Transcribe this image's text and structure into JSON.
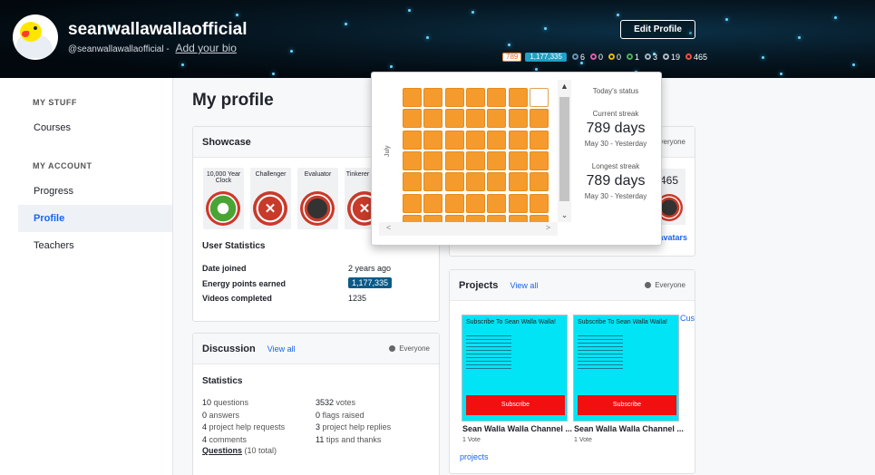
{
  "header": {
    "username": "seanwallawallaofficial",
    "handle": "@seanwallawallaofficial",
    "handle_sep": "-",
    "bio_link": "Add your bio",
    "edit_profile": "Edit Profile",
    "streak": "789",
    "points": "1,177,335",
    "badges": [
      {
        "count": "6",
        "color": "#6b8fb8",
        "icon": "meteorite-badge-icon"
      },
      {
        "count": "0",
        "color": "#e85aa6",
        "icon": "moon-badge-icon"
      },
      {
        "count": "0",
        "color": "#f2b500",
        "icon": "earth-badge-icon"
      },
      {
        "count": "1",
        "color": "#4cb24f",
        "icon": "sun-badge-icon"
      },
      {
        "count": "3",
        "color": "#9fb3c2",
        "icon": "black-hole-badge-icon"
      },
      {
        "count": "19",
        "color": "#b0b8c0",
        "icon": "challenge-patch-icon"
      },
      {
        "count": "465",
        "color": "#e8553d",
        "icon": "avatar-badge-icon"
      }
    ]
  },
  "sidebar": {
    "my_stuff": "MY STUFF",
    "courses": "Courses",
    "my_account": "MY ACCOUNT",
    "progress": "Progress",
    "profile": "Profile",
    "teachers": "Teachers"
  },
  "main": {
    "title": "My profile",
    "showcase": {
      "title": "Showcase",
      "badges": [
        {
          "label": "10,000 Year Clock",
          "icon": "gear-medal-icon"
        },
        {
          "label": "Challenger",
          "icon": "tools-medal-icon"
        },
        {
          "label": "Evaluator",
          "icon": "meteor-medal-icon"
        },
        {
          "label": "Tinkerer",
          "icon": "tools-medal-icon"
        }
      ]
    },
    "user_statistics": {
      "title": "User Statistics",
      "date_joined_label": "Date joined",
      "date_joined": "2 years ago",
      "energy_label": "Energy points earned",
      "energy": "1,177,335",
      "videos_label": "Videos completed",
      "videos": "1235"
    },
    "avatar_card": {
      "visibility": "Everyone",
      "count": "465",
      "link": "ll avatars"
    },
    "discussion": {
      "title": "Discussion",
      "view_all": "View all",
      "visibility": "Everyone",
      "stats_title": "Statistics",
      "left": [
        {
          "n": "10",
          "label": "questions"
        },
        {
          "n": "0",
          "label": "answers"
        },
        {
          "n": "4",
          "label": "project help requests"
        },
        {
          "n": "4",
          "label": "comments"
        }
      ],
      "right": [
        {
          "n": "3532",
          "label": "votes"
        },
        {
          "n": "0",
          "label": "flags raised"
        },
        {
          "n": "3",
          "label": "project help replies"
        },
        {
          "n": "11",
          "label": "tips and thanks"
        }
      ],
      "questions_link": "Questions",
      "questions_total": "(10 total)"
    },
    "projects": {
      "title": "Projects",
      "view_all": "View all",
      "visibility": "Everyone",
      "more": "Cus",
      "items": [
        {
          "thumb_title": "Subscribe To Sean Walla Walla!",
          "button": "Subscribe",
          "title": "Sean Walla Walla Channel ...",
          "votes": "1 Vote"
        },
        {
          "thumb_title": "Subscribe To Sean Walla Walla!",
          "button": "Subscribe",
          "title": "Sean Walla Walla Channel ...",
          "votes": "1 Vote"
        }
      ],
      "footer_link": "projects"
    }
  },
  "streak_popover": {
    "month": "July",
    "today_status": "Today's status",
    "current_label": "Current streak",
    "current_value": "789 days",
    "current_range": "May 30 - Yesterday",
    "longest_label": "Longest streak",
    "longest_value": "789 days",
    "longest_range": "May 30 - Yesterday",
    "scroll_up": "▲",
    "scroll_down": "⌄",
    "scroll_left": "<",
    "scroll_right": ">"
  }
}
